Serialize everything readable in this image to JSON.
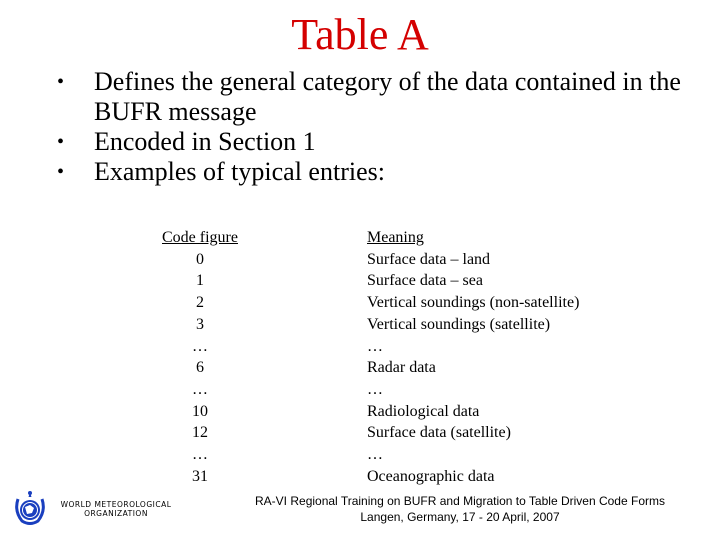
{
  "slide": {
    "title": "Table A",
    "bullets": [
      {
        "marker": "•",
        "text": "Defines the general category of the data contained in the BUFR message"
      },
      {
        "marker": "•",
        "text": "Encoded in Section 1"
      },
      {
        "marker": "•",
        "text": "Examples of typical entries:"
      }
    ],
    "table": {
      "headers": {
        "code": "Code figure",
        "meaning": "Meaning"
      },
      "rows": [
        {
          "code": "0",
          "meaning": "Surface data – land"
        },
        {
          "code": "1",
          "meaning": "Surface data – sea"
        },
        {
          "code": "2",
          "meaning": "Vertical soundings (non-satellite)"
        },
        {
          "code": "3",
          "meaning": "Vertical soundings (satellite)"
        },
        {
          "code": "…",
          "meaning": "…"
        },
        {
          "code": "6",
          "meaning": "Radar data"
        },
        {
          "code": "…",
          "meaning": "…"
        },
        {
          "code": "10",
          "meaning": "Radiological data"
        },
        {
          "code": "12",
          "meaning": "Surface data (satellite)"
        },
        {
          "code": "…",
          "meaning": "…"
        },
        {
          "code": "31",
          "meaning": "Oceanographic data"
        }
      ]
    }
  },
  "footer": {
    "logo_icon": "wmo-emblem-icon",
    "org_line1": "WORLD METEOROLOGICAL",
    "org_line2": "ORGANIZATION",
    "event_line1": "RA-VI Regional Training on BUFR and Migration to Table Driven Code Forms",
    "event_line2": "Langen, Germany, 17 - 20 April, 2007"
  },
  "colors": {
    "title": "#d40000",
    "logo": "#1a3fbf"
  }
}
